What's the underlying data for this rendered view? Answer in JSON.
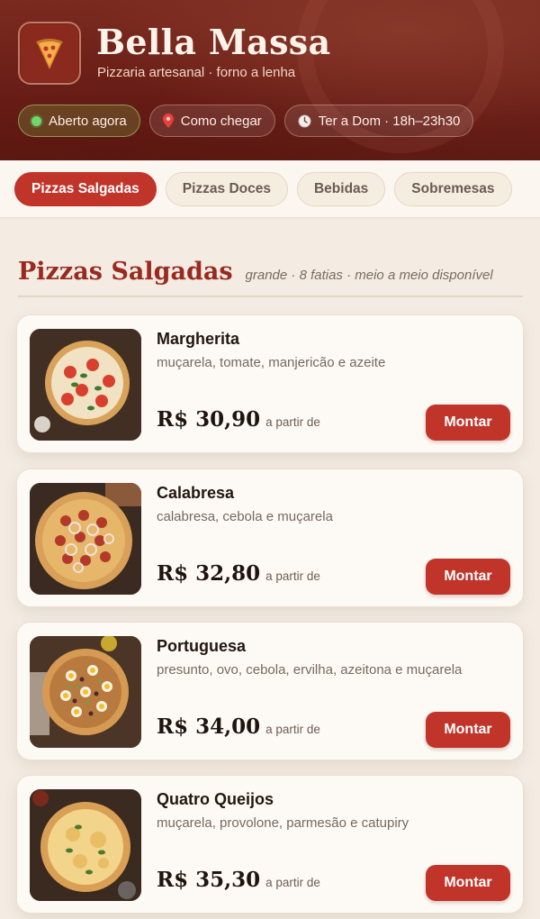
{
  "header": {
    "brand_name": "Bella Massa",
    "brand_subtitle": "Pizzaria artesanal · forno a lenha",
    "logo_icon": "pizza-slice-icon",
    "chips": [
      {
        "label": "Aberto agora",
        "icon": "status-dot-icon",
        "color": "#6fd86b"
      },
      {
        "label": "Como chegar",
        "icon": "map-pin-icon"
      },
      {
        "label": "Ter a Dom · 18h–23h30",
        "icon": "clock-icon"
      }
    ]
  },
  "tabs": [
    {
      "label": "Pizzas Salgadas",
      "active": true
    },
    {
      "label": "Pizzas Doces",
      "active": false
    },
    {
      "label": "Bebidas",
      "active": false
    },
    {
      "label": "Sobremesas",
      "active": false
    }
  ],
  "section": {
    "title": "Pizzas Salgadas",
    "note": "grande · 8 fatias · meio a meio disponível"
  },
  "products": [
    {
      "name": "Margherita",
      "description": "muçarela, tomate, manjericão e azeite",
      "price": "R$ 30,90",
      "price_note": "a partir de",
      "button": "Montar"
    },
    {
      "name": "Calabresa",
      "description": "calabresa, cebola e muçarela",
      "price": "R$ 32,80",
      "price_note": "a partir de",
      "button": "Montar"
    },
    {
      "name": "Portuguesa",
      "description": "presunto, ovo, cebola, ervilha, azeitona e muçarela",
      "price": "R$ 34,00",
      "price_note": "a partir de",
      "button": "Montar"
    },
    {
      "name": "Quatro Queijos",
      "description": "muçarela, provolone, parmesão e catupiry",
      "price": "R$ 35,30",
      "price_note": "a partir de",
      "button": "Montar"
    }
  ],
  "colors": {
    "brand_red": "#c0342a",
    "header_bg": "#6e2119",
    "page_bg": "#f4ece3"
  }
}
